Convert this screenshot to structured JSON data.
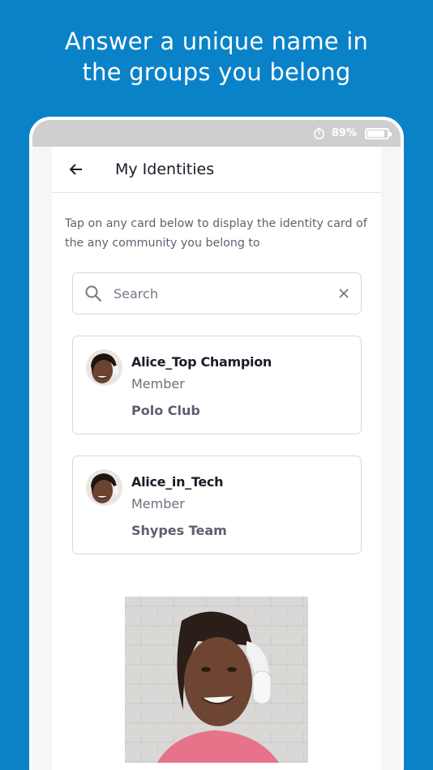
{
  "headline": {
    "line1": "Answer a unique name in",
    "line2": "the groups you belong"
  },
  "status_bar": {
    "clock_icon": "stopwatch-icon",
    "battery_text": "89%",
    "battery_level": 0.89
  },
  "app_bar": {
    "back_icon": "arrow-left-icon",
    "title": "My Identities"
  },
  "intro_text": "Tap on any card below to display the identity card of the any community you belong to",
  "search": {
    "placeholder": "Search",
    "value": "",
    "search_icon": "search-icon",
    "clear_icon": "close-icon"
  },
  "identities": [
    {
      "name": "Alice_Top Champion",
      "role": "Member",
      "group": "Polo Club"
    },
    {
      "name": "Alice_in_Tech",
      "role": "Member",
      "group": "Shypes Team"
    }
  ],
  "colors": {
    "background": "#0a82c8",
    "status_bar": "#cfcfcf",
    "card_border": "#d6d8de",
    "text_dark": "#1c1c28",
    "text_muted": "#6c707c"
  }
}
